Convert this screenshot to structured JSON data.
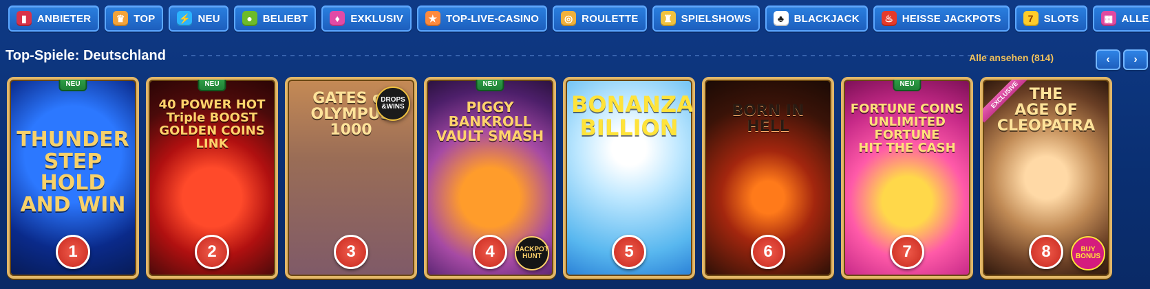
{
  "nav": [
    {
      "label": "ANBIETER",
      "icon": "book-icon",
      "color": "#d8324a",
      "glyph": "▮"
    },
    {
      "label": "TOP",
      "icon": "crown-icon",
      "color": "#f2a33a",
      "glyph": "♛"
    },
    {
      "label": "NEU",
      "icon": "lightning-icon",
      "color": "#2bb3ff",
      "glyph": "⚡"
    },
    {
      "label": "BELIEBT",
      "icon": "apple-icon",
      "color": "#6dbb2a",
      "glyph": "●"
    },
    {
      "label": "EXKLUSIV",
      "icon": "gem-icon",
      "color": "#e24aa6",
      "glyph": "♦"
    },
    {
      "label": "TOP-LIVE-CASINO",
      "icon": "starfish-icon",
      "color": "#ff8a3d",
      "glyph": "★"
    },
    {
      "label": "ROULETTE",
      "icon": "roulette-icon",
      "color": "#f0b13c",
      "glyph": "◎"
    },
    {
      "label": "SPIELSHOWS",
      "icon": "trophy-icon",
      "color": "#f0c23f",
      "glyph": "♜"
    },
    {
      "label": "BLACKJACK",
      "icon": "cards-icon",
      "color": "#ffffff",
      "glyph": "♣"
    },
    {
      "label": "HEISSE JACKPOTS",
      "icon": "chili-icon",
      "color": "#e53a2a",
      "glyph": "🌶"
    },
    {
      "label": "SLOTS",
      "icon": "slot-icon",
      "color": "#ffcc2a",
      "glyph": "7"
    },
    {
      "label": "ALLE SPIELE",
      "icon": "grid-icon",
      "color": "#e04aa0",
      "glyph": "▦"
    }
  ],
  "section": {
    "title": "Top-Spiele: Deutschland",
    "view_all": "Alle ansehen (814)",
    "prev": "‹",
    "next": "›"
  },
  "badges": {
    "new": "NEU",
    "exclusive": "EXCLUSIVE"
  },
  "games": [
    {
      "rank": "1",
      "title": "THUNDER\nSTEP\nHOLD AND WIN",
      "badge": "new",
      "chip": ""
    },
    {
      "rank": "2",
      "title": "40 POWER HOT\nTriple BOOST\nGOLDEN COINS\nLINK",
      "badge": "new",
      "chip": ""
    },
    {
      "rank": "3",
      "title": "GATES of OLYMPUS\n1000",
      "badge": "",
      "chip": "DROPS\n&WINS"
    },
    {
      "rank": "4",
      "title": "PIGGY BANKROLL\nVAULT SMASH",
      "badge": "new",
      "chip": "JACKPOT\nHUNT"
    },
    {
      "rank": "5",
      "title": "BONANZA\nBILLION",
      "badge": "",
      "chip": ""
    },
    {
      "rank": "6",
      "title": "BORN IN HELL",
      "badge": "",
      "chip": ""
    },
    {
      "rank": "7",
      "title": "FORTUNE COINS\nUNLIMITED FORTUNE\nHIT THE CASH",
      "badge": "new",
      "chip": ""
    },
    {
      "rank": "8",
      "title": "THE\nAGE OF\nCLEOPATRA",
      "badge": "exclusive",
      "chip": "BUY\nBONUS"
    }
  ]
}
